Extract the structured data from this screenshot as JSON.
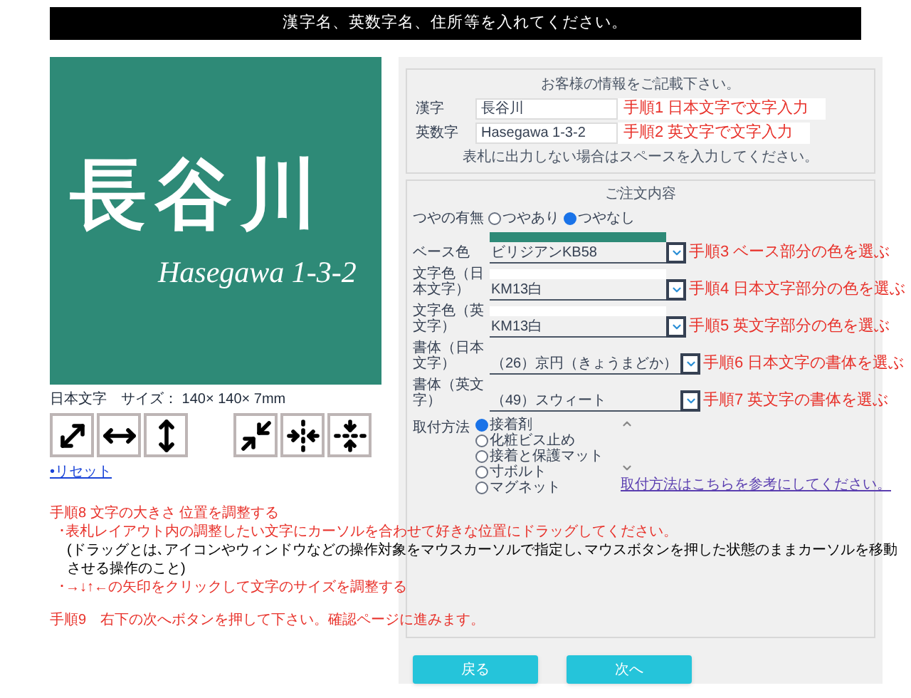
{
  "banner": {
    "text": "漢字名、英数字名、住所等を入れてください。"
  },
  "preview": {
    "name_jp": "長谷川",
    "name_en": "Hasegawa 1-3-2",
    "size_label": "日本文字　サイズ： 140× 140× 7mm"
  },
  "reset_link": "•リセット",
  "instructions": [
    {
      "kind": "step",
      "text": "手順8  文字の大きさ  位置を調整する"
    },
    {
      "kind": "bullet",
      "text": "･表札レイアウト内の調整したい文字にカーソルを合わせて好きな位置にドラッグしてください。"
    },
    {
      "kind": "note",
      "text": "(ドラッグとは､アイコンやウィンドウなどの操作対象をマウスカーソルで指定し､マウスボタンを押した状態のままカーソルを移動させる操作のこと)"
    },
    {
      "kind": "bullet",
      "text": "･→↓↑←の矢印をクリックして文字のサイズを調整する"
    },
    {
      "kind": "step",
      "text": "手順9　右下の次へボタンを押して下さい。確認ページに進みます。"
    }
  ],
  "form": {
    "info_box": {
      "heading": "お客様の情報をご記載下さい。",
      "fields": [
        {
          "label": "漢字",
          "value": "長谷川",
          "annotation": "手順1 日本文字で文字入力"
        },
        {
          "label": "英数字",
          "value": "Hasegawa 1-3-2",
          "annotation": "手順2 英文字で文字入力"
        }
      ],
      "note": "表札に出力しない場合はスペースを入力してください。"
    },
    "order_box": {
      "heading": "ご注文内容",
      "gloss": {
        "label": "つやの有無",
        "options": [
          {
            "label": "つやあり",
            "selected": false
          },
          {
            "label": "つやなし",
            "selected": true
          }
        ]
      },
      "selects": [
        {
          "kind": "color",
          "label": "ベース色",
          "value": "ビリジアンKB58",
          "color": "#2e8a77",
          "annotation": "手順3 ベース部分の色を選ぶ"
        },
        {
          "kind": "color",
          "label": "文字色（日本文字）",
          "value": "KM13白",
          "color": "#ffffff",
          "annotation": "手順4 日本文字部分の色を選ぶ"
        },
        {
          "kind": "color",
          "label": "文字色（英文字）",
          "value": "KM13白",
          "color": "#ffffff",
          "annotation": "手順5 英文字部分の色を選ぶ"
        },
        {
          "kind": "font",
          "label": "書体（日本文字）",
          "value": "（26）京円（きょうまどか）",
          "annotation": "手順6 日本文字の書体を選ぶ"
        },
        {
          "kind": "font",
          "label": "書体（英文字）",
          "value": "（49）スウィート",
          "annotation": "手順7 英文字の書体を選ぶ"
        }
      ],
      "mounting": {
        "label": "取付方法",
        "options": [
          {
            "label": "接着剤",
            "selected": true
          },
          {
            "label": "化粧ビス止め",
            "selected": false
          },
          {
            "label": "接着と保護マット",
            "selected": false
          },
          {
            "label": "寸ボルト",
            "selected": false
          },
          {
            "label": "マグネット",
            "selected": false
          }
        ],
        "link": "取付方法はこちらを参考にしてください。"
      }
    },
    "buttons": [
      {
        "label": "戻る"
      },
      {
        "label": "次へ"
      }
    ]
  }
}
